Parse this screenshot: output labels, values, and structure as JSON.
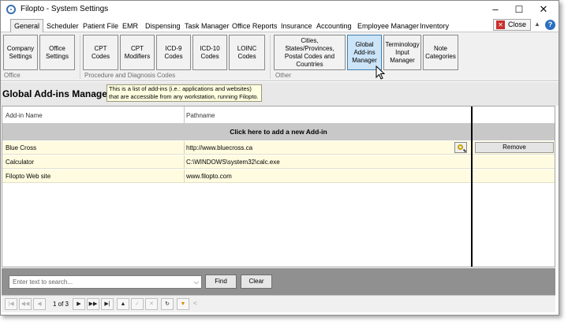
{
  "window": {
    "title": "Filopto - System Settings",
    "minimize_glyph": "–",
    "maximize_glyph": "☐",
    "close_glyph": "✕"
  },
  "tabs": [
    {
      "label": "General",
      "active": true
    },
    {
      "label": "Scheduler"
    },
    {
      "label": "Patient File"
    },
    {
      "label": "EMR"
    },
    {
      "label": "Dispensing"
    },
    {
      "label": "Task Manager"
    },
    {
      "label": "Office Reports"
    },
    {
      "label": "Insurance"
    },
    {
      "label": "Accounting"
    },
    {
      "label": "Employee Manager"
    },
    {
      "label": "Inventory"
    }
  ],
  "top_right": {
    "close_label": "Close",
    "help_glyph": "?",
    "collapse_glyph": "▲"
  },
  "ribbon": {
    "groups": [
      {
        "label": "Office",
        "buttons": [
          "Company Settings",
          "Office Settings"
        ]
      },
      {
        "label": "Procedure and Diagnosis Codes",
        "buttons": [
          "CPT Codes",
          "CPT Modifiers",
          "ICD-9 Codes",
          "ICD-10 Codes",
          "LOINC Codes"
        ]
      },
      {
        "label": "Other",
        "buttons": [
          "Cities, States/Provinces, Postal Codes and Countries",
          "Global Add-ins Manager",
          "Terminology Input Manager",
          "Note Categories"
        ]
      }
    ],
    "selected": "Global Add-ins Manager"
  },
  "header": {
    "title": "Global Add-ins Manager",
    "info_line1": "This is a list of add-ins (i.e.: applications and websites)",
    "info_line2": "that are accessible from any workstation, running Filopto."
  },
  "grid": {
    "columns": [
      "Add-in Name",
      "Pathname"
    ],
    "add_row_label": "Click here to add a new Add-in",
    "rows": [
      {
        "name": "Blue Cross",
        "path": "http://www.bluecross.ca",
        "action": "Remove"
      },
      {
        "name": "Calculator",
        "path": "C:\\WINDOWS\\system32\\calc.exe"
      },
      {
        "name": "Filopto Web site",
        "path": "www.filopto.com"
      }
    ]
  },
  "search": {
    "placeholder": "Enter text to search...",
    "find_label": "Find",
    "clear_label": "Clear"
  },
  "pager": {
    "page_indicator": "1 of 3",
    "first": "|◀",
    "prev_page": "◀◀",
    "prev": "◀",
    "next": "▶",
    "next_page": "▶▶",
    "last": "▶|",
    "up": "▲",
    "check": "✓",
    "cancel": "✕",
    "refresh": "↻",
    "filter": "▼",
    "scroll_left": "<"
  }
}
